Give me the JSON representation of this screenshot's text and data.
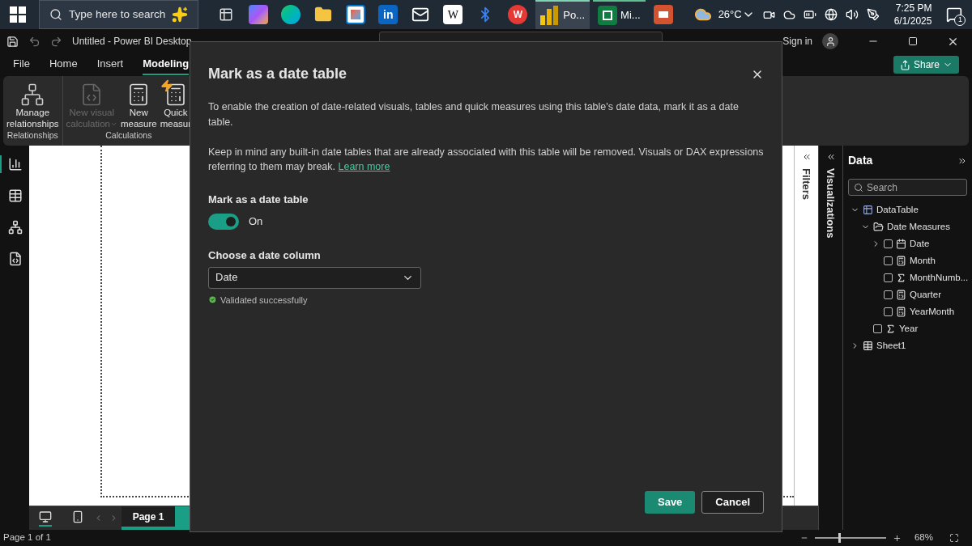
{
  "taskbar": {
    "search": {
      "placeholder": "Type here to search"
    },
    "apps": [
      {
        "kind": "taskview",
        "selected": false
      },
      {
        "kind": "copilot",
        "selected": false
      },
      {
        "kind": "edge",
        "selected": false
      },
      {
        "kind": "explorer",
        "selected": false
      },
      {
        "kind": "store",
        "selected": false
      },
      {
        "kind": "linkedin",
        "label": "in",
        "selected": false
      },
      {
        "kind": "mail",
        "selected": false
      },
      {
        "kind": "wiki",
        "label": "W",
        "selected": false
      },
      {
        "kind": "bluetooth",
        "selected": false
      },
      {
        "kind": "wps",
        "label": "W",
        "selected": false
      },
      {
        "kind": "powerbi",
        "label": "Po...",
        "selected": true
      },
      {
        "kind": "excel",
        "label": "Mi...",
        "selected": false
      },
      {
        "kind": "slides",
        "selected": false
      }
    ],
    "weather": "26°C",
    "time": "7:25 PM",
    "date": "6/1/2025",
    "notifications": "1"
  },
  "window": {
    "title": "Untitled - Power BI Desktop",
    "sign_in": "Sign in",
    "share": "Share"
  },
  "menu": [
    {
      "label": "File",
      "selected": false
    },
    {
      "label": "Home",
      "selected": false
    },
    {
      "label": "Insert",
      "selected": false
    },
    {
      "label": "Modeling",
      "selected": true
    }
  ],
  "ribbon": [
    {
      "label": "Relationships",
      "buttons": [
        {
          "kind": "relationships",
          "lines": [
            "Manage",
            "relationships"
          ],
          "disabled": false,
          "dropdown": false
        }
      ]
    },
    {
      "label": "Calculations",
      "buttons": [
        {
          "kind": "visual-calc",
          "lines": [
            "New visual",
            "calculation"
          ],
          "disabled": true,
          "dropdown": true
        },
        {
          "kind": "measure",
          "lines": [
            "New",
            "measure"
          ],
          "disabled": false,
          "dropdown": false
        },
        {
          "kind": "quick",
          "lines": [
            "Quick",
            "measur"
          ],
          "disabled": false,
          "dropdown": false
        }
      ]
    }
  ],
  "views": [
    {
      "kind": "report",
      "selected": true
    },
    {
      "kind": "table",
      "selected": false
    },
    {
      "kind": "model",
      "selected": false
    },
    {
      "kind": "dax",
      "selected": false
    }
  ],
  "pages": {
    "layouts": [
      {
        "kind": "desktop",
        "selected": true
      },
      {
        "kind": "phone",
        "selected": false
      }
    ],
    "tabs": [
      {
        "label": "Page 1",
        "selected": true
      }
    ]
  },
  "panes": {
    "filters": "Filters",
    "visualizations": "Visualizations"
  },
  "data_pane": {
    "title": "Data",
    "search": {
      "placeholder": "Search"
    },
    "tree": [
      {
        "kind": "calc-table",
        "label": "DataTable",
        "expanded": true,
        "children": [
          {
            "kind": "folder",
            "label": "Date Measures",
            "expanded": true,
            "children": [
              {
                "kind": "date",
                "label": "Date",
                "expanded": false,
                "checked": false
              },
              {
                "kind": "measure",
                "label": "Month",
                "checked": false
              },
              {
                "kind": "sigma",
                "label": "MonthNumb...",
                "checked": false
              },
              {
                "kind": "measure",
                "label": "Quarter",
                "checked": false
              },
              {
                "kind": "measure",
                "label": "YearMonth",
                "checked": false
              }
            ]
          },
          {
            "kind": "sigma",
            "label": "Year",
            "checked": false
          }
        ]
      },
      {
        "kind": "table",
        "label": "Sheet1",
        "expanded": false
      }
    ]
  },
  "status_bar": {
    "page": "Page 1 of 1",
    "zoom": {
      "level": 0.33,
      "reading": "68%"
    }
  },
  "dialog": {
    "title": "Mark as a date table",
    "paragraphs": [
      "To enable the creation of date-related visuals, tables and quick measures using this table's date data, mark it as a date table.",
      "Keep in mind any built-in date tables that are already associated with this table will be removed. Visuals or DAX expressions referring to them may break."
    ],
    "link": "Learn more",
    "toggle": {
      "label": "Mark as a date table",
      "on": true,
      "state_text": "On"
    },
    "column": {
      "label": "Choose a date column",
      "value": "Date",
      "validation": "Validated successfully"
    },
    "buttons": [
      {
        "label": "Save",
        "kind": "primary"
      },
      {
        "label": "Cancel",
        "kind": "secondary"
      }
    ]
  }
}
